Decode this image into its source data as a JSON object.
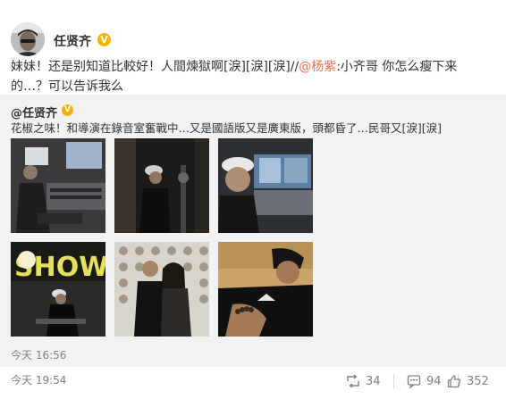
{
  "post": {
    "author": "任贤齐",
    "verified_mark": "V",
    "text_part1": "妹妹！还是别知道比較好！人間煉獄啊[淚][淚][淚]//",
    "mention": "@杨紫",
    "text_part2": ":小齐哥 你怎么瘦下来的…？可以告诉我么",
    "timestamp": "今天 19:54",
    "repost_count": "34",
    "comment_count": "94",
    "like_count": "352"
  },
  "original": {
    "author": "@任贤齐",
    "verified_mark": "V",
    "text": "花椒之味！和導演在錄音室奮戰中…又是國語版又是廣東版，頭都昏了…民哥又[淚][淚]",
    "timestamp": "今天 16:56",
    "photos": [
      {
        "subject": "man-at-mixing-console"
      },
      {
        "subject": "man-in-cap-at-microphone"
      },
      {
        "subject": "smiling-man-in-white-cap"
      },
      {
        "subject": "man-seated-under-show-sign",
        "sign_text": "SHOW"
      },
      {
        "subject": "two-people-posing-at-wall"
      },
      {
        "subject": "man-in-dark-tee-with-bracelet"
      }
    ]
  },
  "icons": {
    "repost": "repost-icon",
    "comment": "comment-icon",
    "like": "thumbs-up-icon"
  },
  "colors": {
    "mention": "#eb7350",
    "verified": "#f6b400",
    "repost_background": "#f2f2f5",
    "meta_text": "#808080"
  }
}
